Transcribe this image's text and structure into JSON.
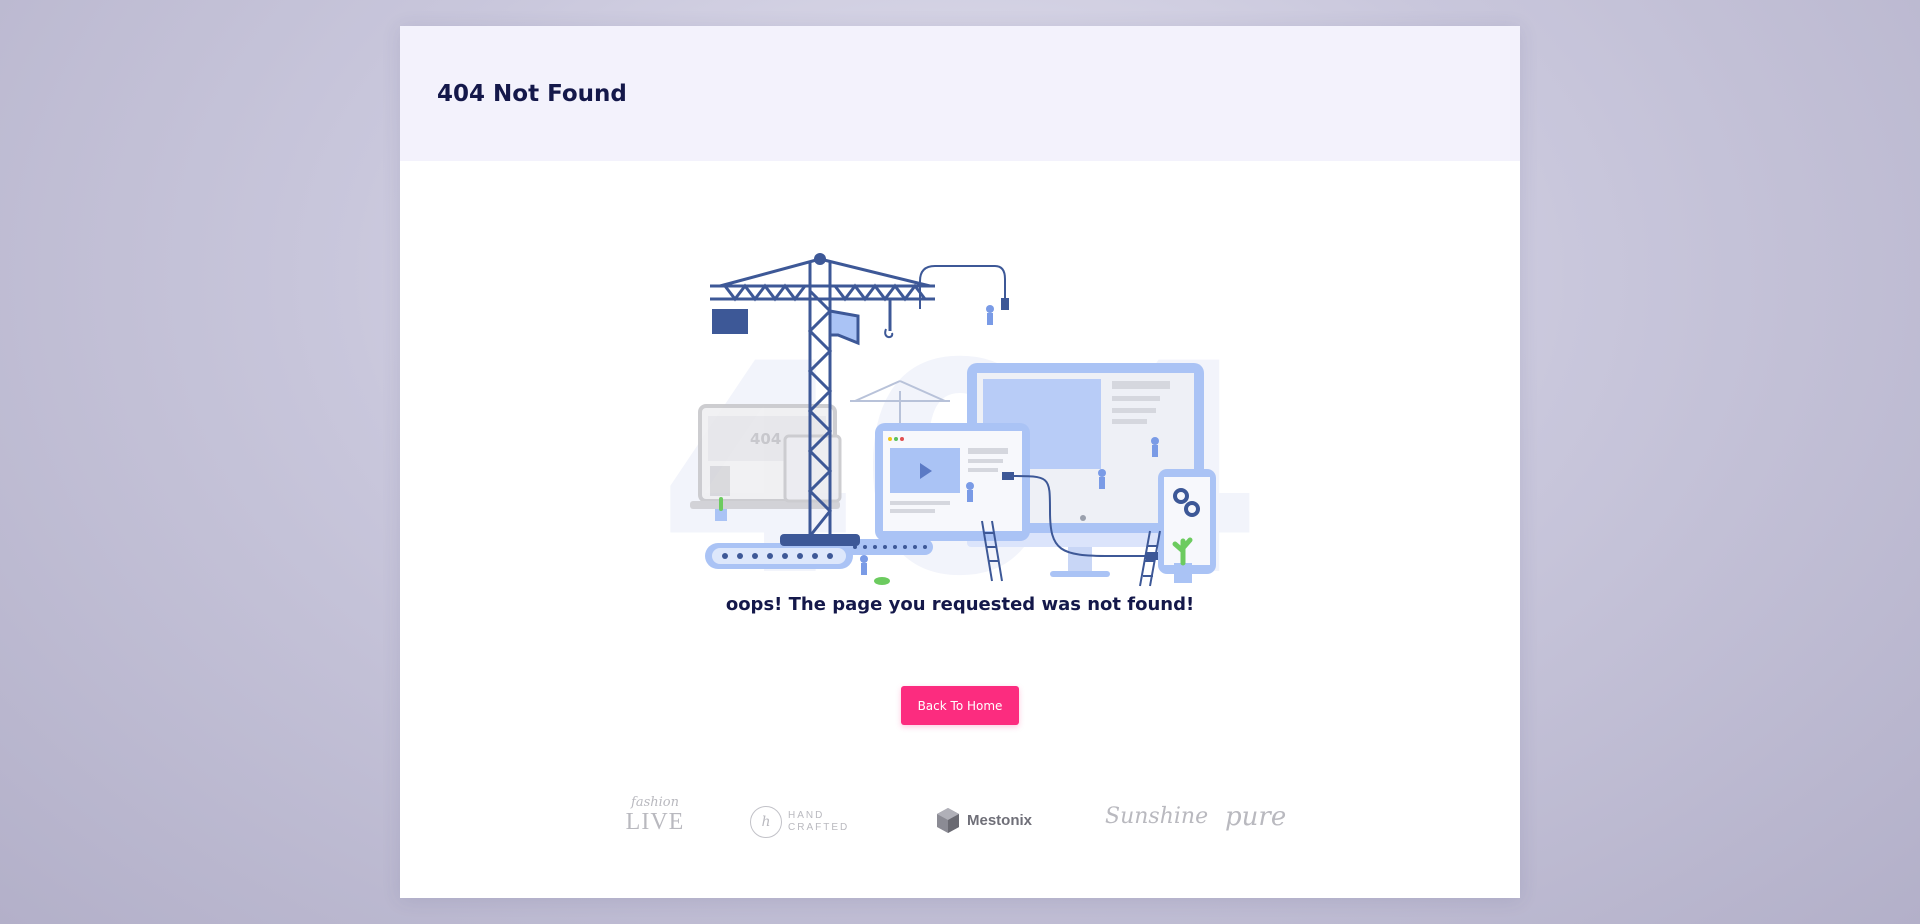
{
  "header": {
    "title": "404 Not Found"
  },
  "main": {
    "message": "oops! The page you requested was not found!",
    "back_button_label": "Back To Home",
    "illustration": {
      "icon": "construction-404-illustration",
      "watermark_text": "404",
      "small_screen_text": "404"
    }
  },
  "brands": [
    {
      "name": "fashion LIVE",
      "script": "fashion",
      "big": "LIVE"
    },
    {
      "name": "HAND CRAFTED",
      "badge": "h",
      "line1": "HAND",
      "line2": "CRAFTED"
    },
    {
      "name": "Mestonix"
    },
    {
      "name": "Sunshine"
    },
    {
      "name": "pure"
    }
  ],
  "colors": {
    "primary_text": "#14184a",
    "accent": "#fc2c7f",
    "header_bg": "#f3f2fc",
    "illustration_dark": "#3d5897",
    "illustration_light": "#aac3f5"
  }
}
